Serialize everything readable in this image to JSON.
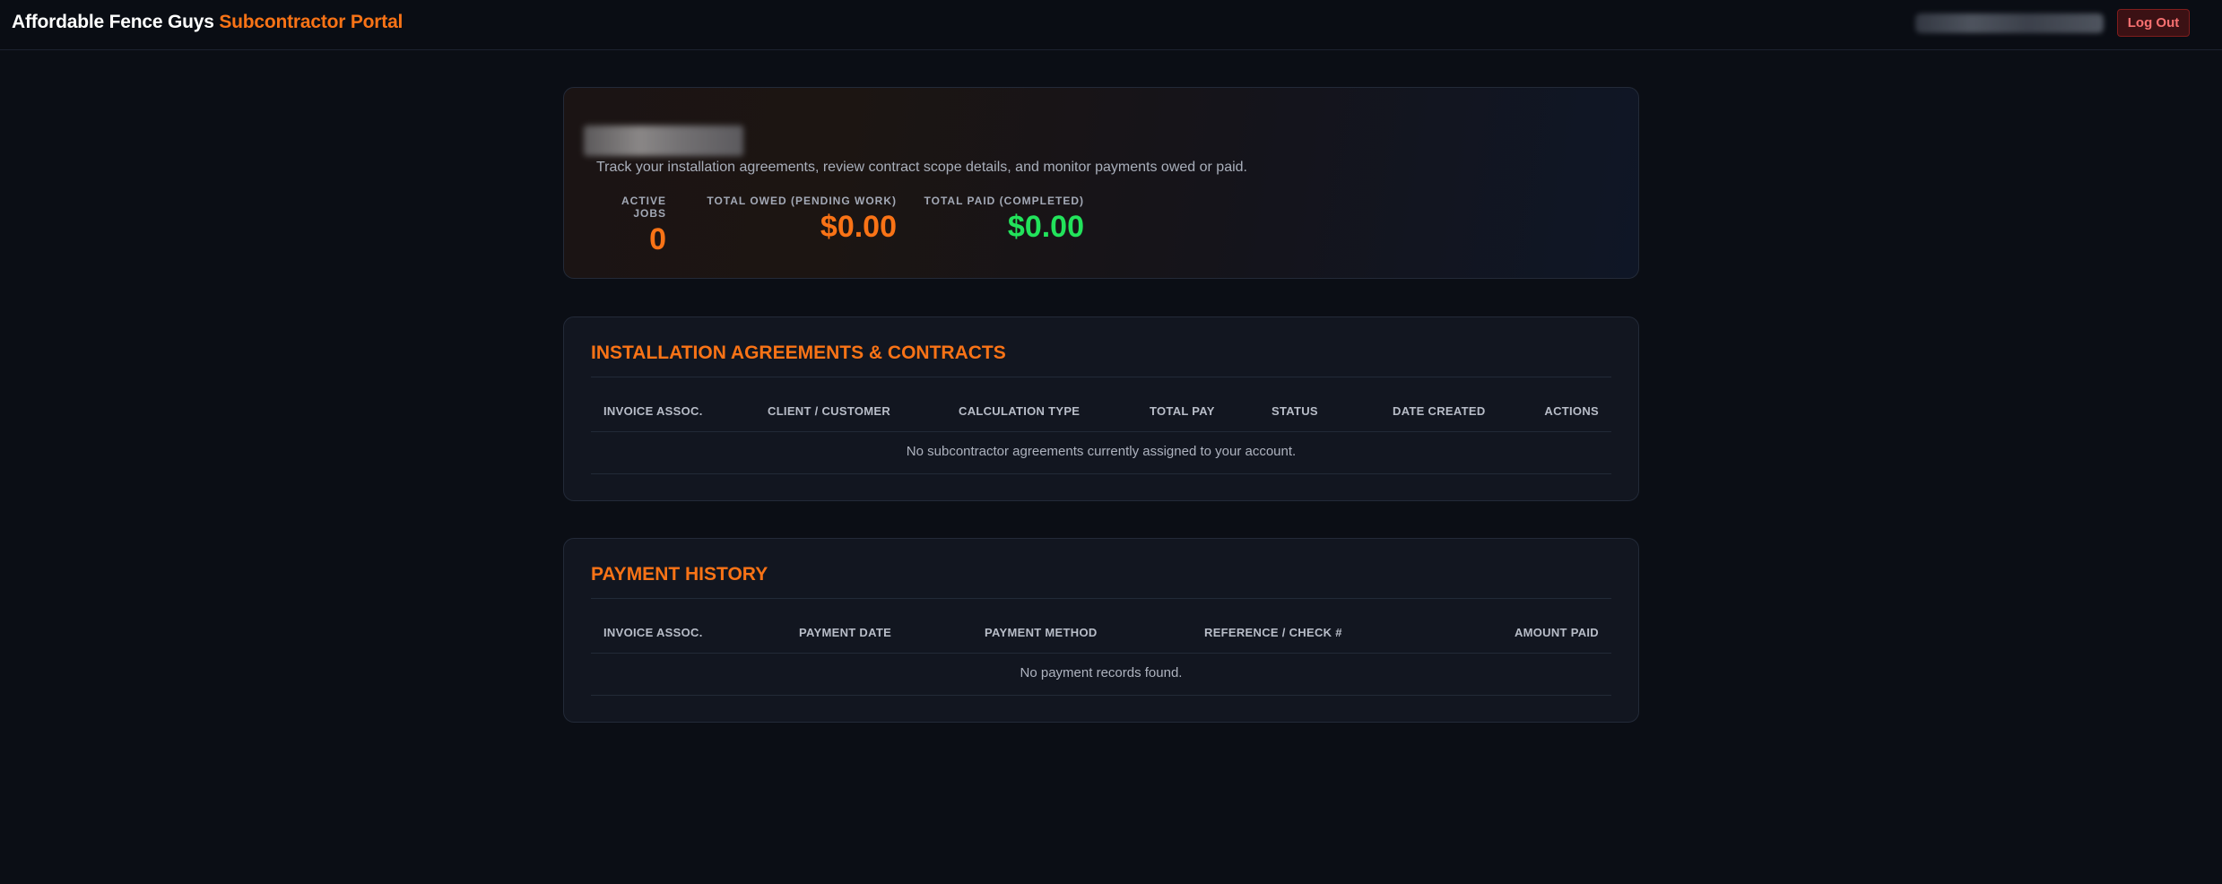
{
  "header": {
    "brand_primary": "Affordable Fence Guys",
    "brand_secondary": "Subcontractor Portal",
    "logout_label": "Log Out"
  },
  "hero": {
    "subtitle": "Track your installation agreements, review contract scope details, and monitor payments owed or paid.",
    "stats": [
      {
        "label": "ACTIVE JOBS",
        "value": "0"
      },
      {
        "label": "TOTAL OWED (PENDING WORK)",
        "value": "$0.00"
      },
      {
        "label": "TOTAL PAID (COMPLETED)",
        "value": "$0.00"
      }
    ]
  },
  "agreements": {
    "title": "INSTALLATION AGREEMENTS & CONTRACTS",
    "columns": [
      "INVOICE ASSOC.",
      "CLIENT / CUSTOMER",
      "CALCULATION TYPE",
      "TOTAL PAY",
      "STATUS",
      "DATE CREATED",
      "ACTIONS"
    ],
    "empty_message": "No subcontractor agreements currently assigned to your account."
  },
  "payments": {
    "title": "PAYMENT HISTORY",
    "columns": [
      "INVOICE ASSOC.",
      "PAYMENT DATE",
      "PAYMENT METHOD",
      "REFERENCE / CHECK #",
      "AMOUNT PAID"
    ],
    "empty_message": "No payment records found."
  },
  "colors": {
    "accent": "#f97316",
    "paid": "#22e35b",
    "logout": "#f87171",
    "background": "#0b0e15"
  }
}
